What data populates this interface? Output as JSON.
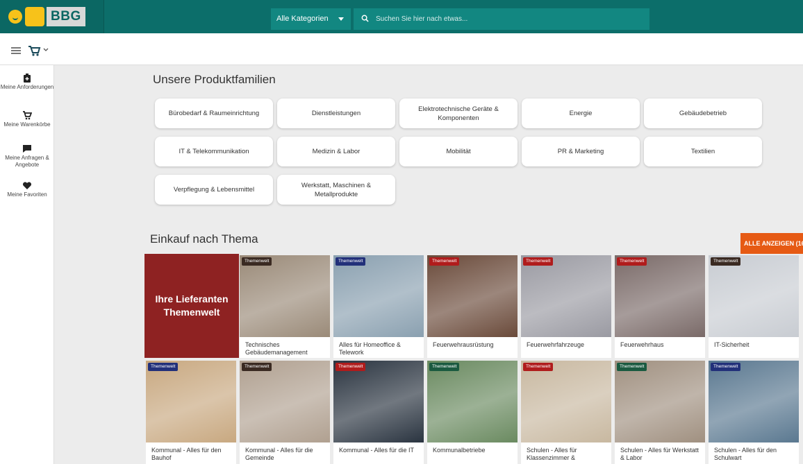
{
  "topbar": {
    "logo_text": "BBG",
    "category_label": "Alle Kategorien",
    "search_placeholder": "Suchen Sie hier nach etwas..."
  },
  "sidebar": {
    "items": [
      {
        "label": "Meine Anforderungen",
        "icon": "clipboard-icon"
      },
      {
        "label": "Meine Warenkörbe",
        "icon": "cart-icon"
      },
      {
        "label": "Meine Anfragen & Angebote",
        "icon": "chat-icon"
      },
      {
        "label": "Meine Favoriten",
        "icon": "heart-icon"
      }
    ]
  },
  "produktfamilien": {
    "title": "Unsere Produktfamilien",
    "items": [
      "Bürobedarf & Raumeinrichtung",
      "Dienstleistungen",
      "Elektrotechnische Geräte & Komponenten",
      "Energie",
      "Gebäudebetrieb",
      "IT & Telekommunikation",
      "Medizin & Labor",
      "Mobilität",
      "PR & Marketing",
      "Textilien",
      "Verpflegung & Lebensmittel",
      "Werkstatt, Maschinen & Metallprodukte"
    ]
  },
  "thema": {
    "title": "Einkauf nach Thema",
    "alle_label": "ALLE ANZEIGEN (16",
    "lieferanten_label": "Ihre Lieferanten Themenwelt",
    "badge_label": "Themenwelt",
    "cards": [
      {
        "caption": "Technisches Gebäudemanagement",
        "badge_color": "#3a2a22",
        "bg": "#9a8a78"
      },
      {
        "caption": "Alles für Homeoffice & Telework",
        "badge_color": "#22307a",
        "bg": "#8aa0b0"
      },
      {
        "caption": "Feuerwehrausrüstung",
        "badge_color": "#b01c1c",
        "bg": "#6a4a3a"
      },
      {
        "caption": "Feuerwehrfahrzeuge",
        "badge_color": "#b01c1c",
        "bg": "#9a9aa2"
      },
      {
        "caption": "Feuerwehrhaus",
        "badge_color": "#b01c1c",
        "bg": "#7a6a68"
      },
      {
        "caption": "IT-Sicherheit",
        "badge_color": "#3a2a22",
        "bg": "#c8ccd2"
      },
      {
        "caption": "Kommunal - Alles für den Bauhof",
        "badge_color": "#22307a",
        "bg": "#c8a880"
      },
      {
        "caption": "Kommunal - Alles für die Gemeinde",
        "badge_color": "#3a2a22",
        "bg": "#b0a090"
      },
      {
        "caption": "Kommunal - Alles für die IT",
        "badge_color": "#b01c1c",
        "bg": "#2a3440"
      },
      {
        "caption": "Kommunalbetriebe",
        "badge_color": "#1a5a40",
        "bg": "#6a8a60"
      },
      {
        "caption": "Schulen - Alles für Klassenzimmer &",
        "badge_color": "#b01c1c",
        "bg": "#c8b8a0"
      },
      {
        "caption": "Schulen - Alles für Werkstatt & Labor",
        "badge_color": "#1a5a40",
        "bg": "#a09080"
      },
      {
        "caption": "Schulen - Alles für den Schulwart",
        "badge_color": "#22307a",
        "bg": "#5a7890"
      }
    ]
  }
}
